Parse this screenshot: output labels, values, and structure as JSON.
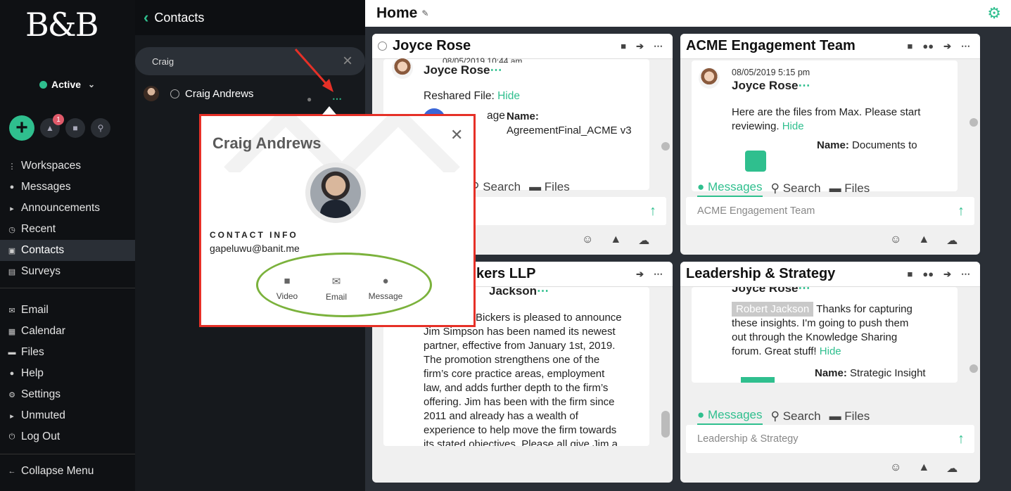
{
  "nav": {
    "logo": "B&B",
    "status": "Active",
    "alert_count": "1",
    "items_top": [
      {
        "label": "Workspaces",
        "icon": "grid-icon"
      },
      {
        "label": "Messages",
        "icon": "chat-icon"
      },
      {
        "label": "Announcements",
        "icon": "megaphone-icon"
      },
      {
        "label": "Recent",
        "icon": "clock-icon"
      },
      {
        "label": "Contacts",
        "icon": "contacts-icon"
      },
      {
        "label": "Surveys",
        "icon": "clipboard-icon"
      }
    ],
    "items_bottom": [
      {
        "label": "Email",
        "icon": "mail-icon"
      },
      {
        "label": "Calendar",
        "icon": "calendar-icon"
      },
      {
        "label": "Files",
        "icon": "folder-icon"
      },
      {
        "label": "Help",
        "icon": "help-icon"
      },
      {
        "label": "Settings",
        "icon": "gear-icon"
      },
      {
        "label": "Unmuted",
        "icon": "speaker-icon"
      },
      {
        "label": "Log Out",
        "icon": "power-icon"
      }
    ],
    "collapse": "Collapse Menu",
    "active_item": "Contacts"
  },
  "contacts": {
    "title": "Contacts",
    "search_value": "Craig",
    "result_name": "Craig Andrews"
  },
  "popup": {
    "name": "Craig Andrews",
    "contact_info_label": "CONTACT INFO",
    "email": "gapeluwu@banit.me",
    "actions": [
      "Video",
      "Email",
      "Message"
    ]
  },
  "main": {
    "title": "Home",
    "cards": [
      {
        "title": "Joyce Rose",
        "date_partial": "08/05/2019 10:44 am",
        "sender": "Joyce Rose",
        "reshared_label": "Reshared File:",
        "hide": "Hide",
        "file_label_left": "age",
        "file_name_label": "Name:",
        "file_name": "AgreementFinal_ACME v3",
        "tabs": [
          "Search",
          "Files"
        ]
      },
      {
        "title": "ACME Engagement Team",
        "date": "08/05/2019 5:15 pm",
        "sender": "Joyce Rose",
        "message": "Here are the files from Max. Please start reviewing.",
        "hide": "Hide",
        "file_name_label": "Name:",
        "file_name": "Documents to",
        "tabs": [
          "Messages",
          "Search",
          "Files"
        ],
        "input_placeholder": "ACME Engagement Team"
      },
      {
        "title": "kers LLP",
        "sender": "Jackson",
        "message_lines": [
          "Bickers is pleased to announce",
          "Jim Simpson has been named its newest",
          "partner, effective from January 1st, 2019.",
          "The promotion strengthens one of the",
          "firm’s core practice areas, employment",
          "law, and adds further depth to the firm’s",
          "offering. Jim has been with the firm since",
          "2011 and already has a wealth of",
          "experience to help move the firm towards",
          "its stated objectives. Please all give Jim a"
        ]
      },
      {
        "title": "Leadership & Strategy",
        "sender": "Joyce Rose",
        "mention": "Robert Jackson",
        "message_lines": [
          "Thanks for capturing",
          "these insights.  I'm going to push them",
          "out through the Knowledge Sharing",
          "forum.  Great stuff!"
        ],
        "hide": "Hide",
        "file_name_label": "Name:",
        "file_name": "Strategic Insight",
        "tabs": [
          "Messages",
          "Search",
          "Files"
        ],
        "input_placeholder": "Leadership & Strategy"
      }
    ]
  },
  "colors": {
    "accent": "#2fbf8e",
    "annotation_red": "#e63027",
    "annotation_green": "#7bb23c"
  }
}
